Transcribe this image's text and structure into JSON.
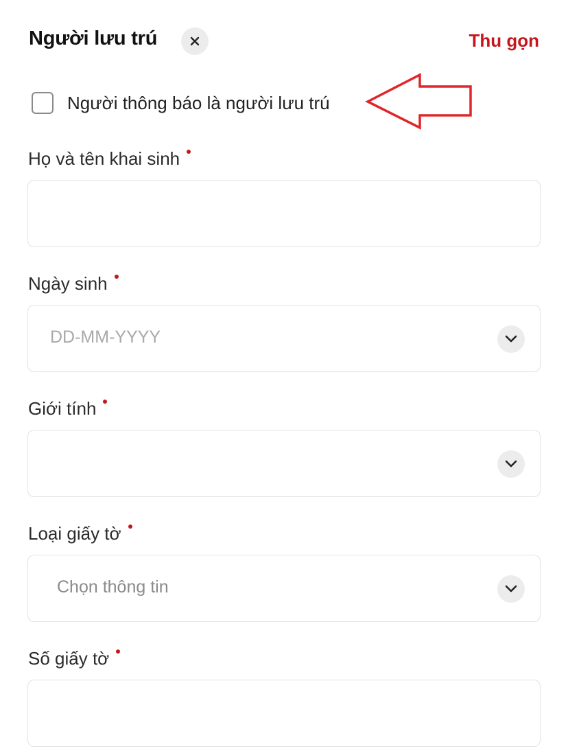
{
  "header": {
    "title": "Người lưu trú",
    "close_icon": "close-icon",
    "collapse_label": "Thu gọn"
  },
  "checkbox": {
    "label": "Người thông báo là người lưu trú",
    "checked": false
  },
  "annotation": {
    "arrow_color": "#e0262b"
  },
  "fields": {
    "full_name": {
      "label": "Họ và tên khai sinh",
      "required": true,
      "value": ""
    },
    "birth_date": {
      "label": "Ngày sinh",
      "required": true,
      "placeholder": "DD-MM-YYYY",
      "icon": "chevron-down-icon"
    },
    "gender": {
      "label": "Giới tính",
      "required": true,
      "value": "",
      "icon": "chevron-down-icon"
    },
    "doc_type": {
      "label": "Loại giấy tờ",
      "required": true,
      "placeholder": "Chọn thông tin",
      "icon": "chevron-down-icon"
    },
    "doc_number": {
      "label": "Số giấy tờ",
      "required": true,
      "value": ""
    }
  },
  "colors": {
    "accent": "#c4161c",
    "border": "#e2e2e2"
  }
}
